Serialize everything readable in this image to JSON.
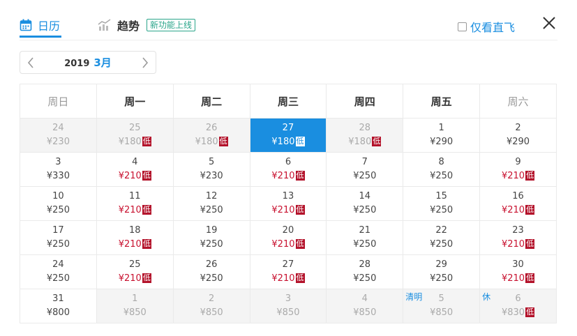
{
  "tabs": {
    "calendar_label": "日历",
    "trend_label": "趋势",
    "new_feature_badge": "新功能上线"
  },
  "direct_only": {
    "label": "仅看直飞",
    "checked": false
  },
  "month_nav": {
    "year": "2019",
    "month": "3月"
  },
  "weekdays": [
    "周日",
    "周一",
    "周二",
    "周三",
    "周四",
    "周五",
    "周六"
  ],
  "colors": {
    "accent": "#1a8ee0",
    "low_price": "#c8102e",
    "low_tag": "#b3122a"
  },
  "weeks": [
    [
      {
        "day": "24",
        "price": "¥230",
        "faded": true
      },
      {
        "day": "25",
        "price": "¥180",
        "low": true,
        "faded": true
      },
      {
        "day": "26",
        "price": "¥180",
        "low": true,
        "faded": true
      },
      {
        "day": "27",
        "price": "¥180",
        "low": true,
        "selected": true
      },
      {
        "day": "28",
        "price": "¥180",
        "low": true,
        "faded": true
      },
      {
        "day": "1",
        "price": "¥290"
      },
      {
        "day": "2",
        "price": "¥290"
      }
    ],
    [
      {
        "day": "3",
        "price": "¥330"
      },
      {
        "day": "4",
        "price": "¥210",
        "low": true
      },
      {
        "day": "5",
        "price": "¥230"
      },
      {
        "day": "6",
        "price": "¥210",
        "low": true
      },
      {
        "day": "7",
        "price": "¥250"
      },
      {
        "day": "8",
        "price": "¥250"
      },
      {
        "day": "9",
        "price": "¥210",
        "low": true
      }
    ],
    [
      {
        "day": "10",
        "price": "¥250"
      },
      {
        "day": "11",
        "price": "¥210",
        "low": true
      },
      {
        "day": "12",
        "price": "¥250"
      },
      {
        "day": "13",
        "price": "¥210",
        "low": true
      },
      {
        "day": "14",
        "price": "¥250"
      },
      {
        "day": "15",
        "price": "¥250"
      },
      {
        "day": "16",
        "price": "¥210",
        "low": true
      }
    ],
    [
      {
        "day": "17",
        "price": "¥250"
      },
      {
        "day": "18",
        "price": "¥210",
        "low": true
      },
      {
        "day": "19",
        "price": "¥250"
      },
      {
        "day": "20",
        "price": "¥210",
        "low": true
      },
      {
        "day": "21",
        "price": "¥250"
      },
      {
        "day": "22",
        "price": "¥250"
      },
      {
        "day": "23",
        "price": "¥210",
        "low": true
      }
    ],
    [
      {
        "day": "24",
        "price": "¥250"
      },
      {
        "day": "25",
        "price": "¥210",
        "low": true
      },
      {
        "day": "26",
        "price": "¥250"
      },
      {
        "day": "27",
        "price": "¥210",
        "low": true
      },
      {
        "day": "28",
        "price": "¥250"
      },
      {
        "day": "29",
        "price": "¥250"
      },
      {
        "day": "30",
        "price": "¥210",
        "low": true
      }
    ],
    [
      {
        "day": "31",
        "price": "¥800"
      },
      {
        "day": "1",
        "price": "¥850",
        "faded": true
      },
      {
        "day": "2",
        "price": "¥850",
        "faded": true
      },
      {
        "day": "3",
        "price": "¥850",
        "faded": true
      },
      {
        "day": "4",
        "price": "¥850",
        "faded": true
      },
      {
        "day": "5",
        "price": "¥850",
        "faded": true,
        "holiday": "清明"
      },
      {
        "day": "6",
        "price": "¥830",
        "low": true,
        "faded": true,
        "holiday": "休"
      }
    ]
  ],
  "low_tag_label": "低"
}
